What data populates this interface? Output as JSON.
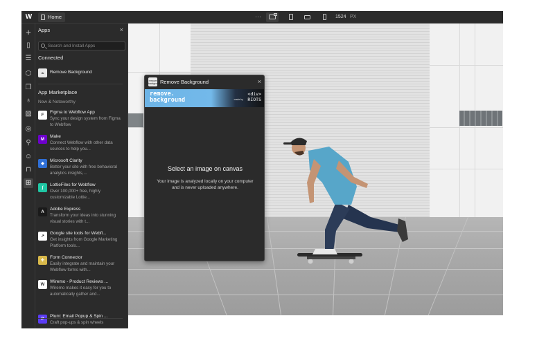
{
  "topbar": {
    "logo": "W",
    "home_tab": "Home",
    "more": "···",
    "width_value": "1524",
    "width_unit": "PX"
  },
  "apps_panel": {
    "title": "Apps",
    "close": "×",
    "search_placeholder": "Search and Install Apps",
    "connected_heading": "Connected",
    "connected_app": "Remove Background",
    "marketplace_heading": "App Marketplace",
    "marketplace_subheading": "New & Noteworthy",
    "apps": [
      {
        "name": "Figma to Webflow App",
        "desc": "Sync your design system from Figma to Webflow",
        "color": "#ffffff",
        "glyph": "F"
      },
      {
        "name": "Make",
        "desc": "Connect Webflow with other data sources to help you...",
        "color": "#6d00cc",
        "glyph": "M"
      },
      {
        "name": "Microsoft Clarity",
        "desc": "Better your site with free behavioral analytics insights,...",
        "color": "#2f6fd6",
        "glyph": "◆"
      },
      {
        "name": "LottieFiles for Webflow",
        "desc": "Over 100,000+ free, highly customizable Lottie...",
        "color": "#1fc7a4",
        "glyph": "∫"
      },
      {
        "name": "Adobe Express",
        "desc": "Transform your ideas into stunning visual stories with t...",
        "color": "#1a1a1a",
        "glyph": "A"
      },
      {
        "name": "Google site tools for Webfl...",
        "desc": "Get insights from Google Marketing Platform tools...",
        "color": "#ffffff",
        "glyph": "↗"
      },
      {
        "name": "Form Connector",
        "desc": "Easily integrate and maintain your Webflow forms with...",
        "color": "#d8b84a",
        "glyph": "✣"
      },
      {
        "name": "Wiremo - Product Reviews ...",
        "desc": "Wiremo makes it easy for you to automatically gather and...",
        "color": "#ffffff",
        "glyph": "W"
      },
      {
        "name": "Plum: Email Popup & Spin ...",
        "desc": "Craft pop-ups & spin wheels",
        "color": "#5b3cf5",
        "glyph": "P"
      }
    ]
  },
  "modal": {
    "title": "Remove Background",
    "close": "×",
    "banner_title_line1": "remove.",
    "banner_title_line2": "background",
    "banner_brand_line1": "<div>",
    "banner_brand_line2": "RIOTS",
    "banner_made_by": "made by",
    "icon_text": "remove background",
    "heading": "Select an image on canvas",
    "text": "Your image is analyzed locally on your computer and is never uploaded anywhere."
  },
  "colors": {
    "panel_bg": "#2b2b2b",
    "banner_blue": "#6db4e6",
    "shirt": "#57a6c9"
  }
}
